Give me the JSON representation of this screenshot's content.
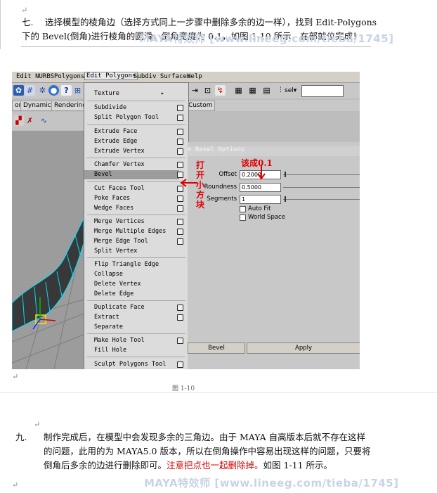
{
  "top_para": {
    "number": "七.",
    "line1": "选择模型的棱角边（选择方式同上一步骤中删除多余的边一样），找到 Edit-Polygons",
    "line2": "下的 Bevel(倒角)进行棱角的圆滑，倒角宽度为 0.1，如图 1-10 所示，在部就位完成！"
  },
  "watermark": "MAYA特效师 [www.lineeg.com/tieba/1745]",
  "menubar": [
    "Edit NURBS",
    "Polygons",
    "Edit Polygons",
    "Subdiv Surfaces",
    "Help"
  ],
  "tabs": [
    "on",
    "Dynamics",
    "Rendering",
    "Custom"
  ],
  "toolbar_select": "sel",
  "menu": {
    "items": [
      "Texture",
      "Subdivide",
      "Split Polygon Tool",
      "Extrude Face",
      "Extrude Edge",
      "Extrude Vertex",
      "Chamfer Vertex",
      "Bevel",
      "Cut Faces Tool",
      "Poke Faces",
      "Wedge Faces",
      "Merge Vertices",
      "Merge Multiple Edges",
      "Merge Edge Tool",
      "Split Vertex",
      "Flip Triangle Edge",
      "Collapse",
      "Delete Vertex",
      "Delete Edge",
      "Duplicate Face",
      "Extract",
      "Separate",
      "Make Hole Tool",
      "Fill Hole",
      "Sculpt Polygons Tool"
    ],
    "submenu_arrow": "▸"
  },
  "bevel_options": {
    "title": "n Bevel Options",
    "offset_label": "Offset",
    "offset_value": "0.2000",
    "roundness_label": "Roundness",
    "roundness_value": "0.5000",
    "segments_label": "Segments",
    "segments_value": "1",
    "autofit_label": "Auto Fit",
    "worldspace_label": "World Space",
    "bevel_button": "Bevel",
    "apply_button": "Apply"
  },
  "annotations": {
    "change_to": "该成0.1",
    "open_box": "打开小方块"
  },
  "caption": "图 1-10",
  "bottom_para": {
    "number": "九.",
    "line1": "制作完成后，在模型中会发现多余的三角边。由于 MAYA 自高版本后就不存在这样",
    "line2": "的问题，此用的为 MAYA5.0 版本，所以在倒角操作中容易出现这样的问题，只要将",
    "line3a": "倒角后多余的边进行删除即可。",
    "line3red": "注意把点也一起删除掉。",
    "line3b": "如图 1-11 所示。"
  },
  "colors": {
    "red": "#e00000",
    "menu_bg": "#dcdcdc",
    "highlight": "#9c9c9c"
  }
}
